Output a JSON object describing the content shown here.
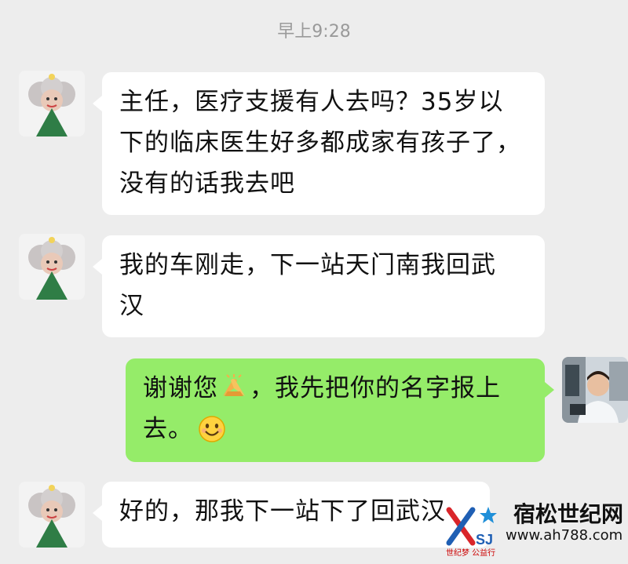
{
  "timestamp": "早上9:28",
  "messages": [
    {
      "direction": "incoming",
      "lines": [
        "主任，医疗支援有人去吗？35岁以",
        "下的临床医生好多都成家有孩子了，",
        "没有的话我去吧"
      ]
    },
    {
      "direction": "incoming",
      "lines": [
        "我的车刚走，下一站天门南我回武",
        "汉"
      ]
    },
    {
      "direction": "outgoing",
      "line1_before_emoji": "谢谢您",
      "line1_emoji": "handshake-emoji",
      "line1_after_emoji": "，我先把你的名字报上",
      "line2_text": "去。",
      "line2_emoji": "smile-emoji"
    },
    {
      "direction": "incoming",
      "lines": [
        "好的，那我下一站下了回武汉"
      ]
    }
  ],
  "watermark": {
    "site_name": "宿松世纪网",
    "site_url": "www.ah788.com",
    "logo_text": "SJ",
    "tagline": "世纪梦 公益行"
  },
  "colors": {
    "background": "#ededed",
    "incoming_bubble": "#ffffff",
    "outgoing_bubble": "#95ec69",
    "timestamp_text": "#9a9a9a"
  }
}
